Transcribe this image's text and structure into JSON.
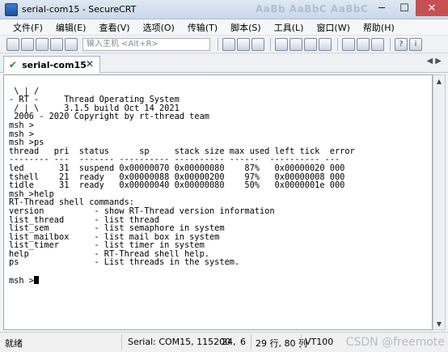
{
  "window": {
    "title": "serial-com15 - SecureCRT",
    "title_deco": "AaBb AaBbC AaBbC",
    "min": "─",
    "max": "☐",
    "close": "✕"
  },
  "menu": [
    "文件(F)",
    "编辑(E)",
    "查看(V)",
    "选项(O)",
    "传输(T)",
    "脚本(S)",
    "工具(L)",
    "窗口(W)",
    "帮助(H)"
  ],
  "toolbar": {
    "quick_connect_placeholder": "输入主机 <Alt+R>",
    "help_glyph": "?",
    "info_glyph": "i"
  },
  "tab": {
    "check": "✔",
    "label": "serial-com15",
    "close": "✕",
    "scroll": "◀ ▶"
  },
  "terminal": {
    "lines": [
      "",
      " \\ | /",
      "- RT -     Thread Operating System",
      " / | \\     3.1.5 build Oct 14 2021",
      " 2006 - 2020 Copyright by rt-thread team",
      "msh >",
      "msh >",
      "msh >ps",
      "thread   pri  status      sp     stack size max used left tick  error",
      "-------- ---  ------- ---------- ---------- ------  ---------- ---",
      "led       31  suspend 0x00000070 0x00000080    87%   0x00000020 000",
      "tshell    21  ready   0x00000088 0x00000200    97%   0x00000008 000",
      "tidle     31  ready   0x00000040 0x00000080    50%   0x0000001e 000",
      "msh >help",
      "RT-Thread shell commands:",
      "version          - show RT-Thread version information",
      "list_thread      - list thread",
      "list_sem         - list semaphore in system",
      "list_mailbox     - list mail box in system",
      "list_timer       - list timer in system",
      "help             - RT-Thread shell help.",
      "ps               - List threads in the system.",
      "",
      "msh >"
    ]
  },
  "status": {
    "ready": "就绪",
    "serial": "Serial: COM15, 115200",
    "row": "24,",
    "col": "6",
    "size": "29 行, 80 列",
    "term": "VT100",
    "watermark": "CSDN @freemote"
  }
}
